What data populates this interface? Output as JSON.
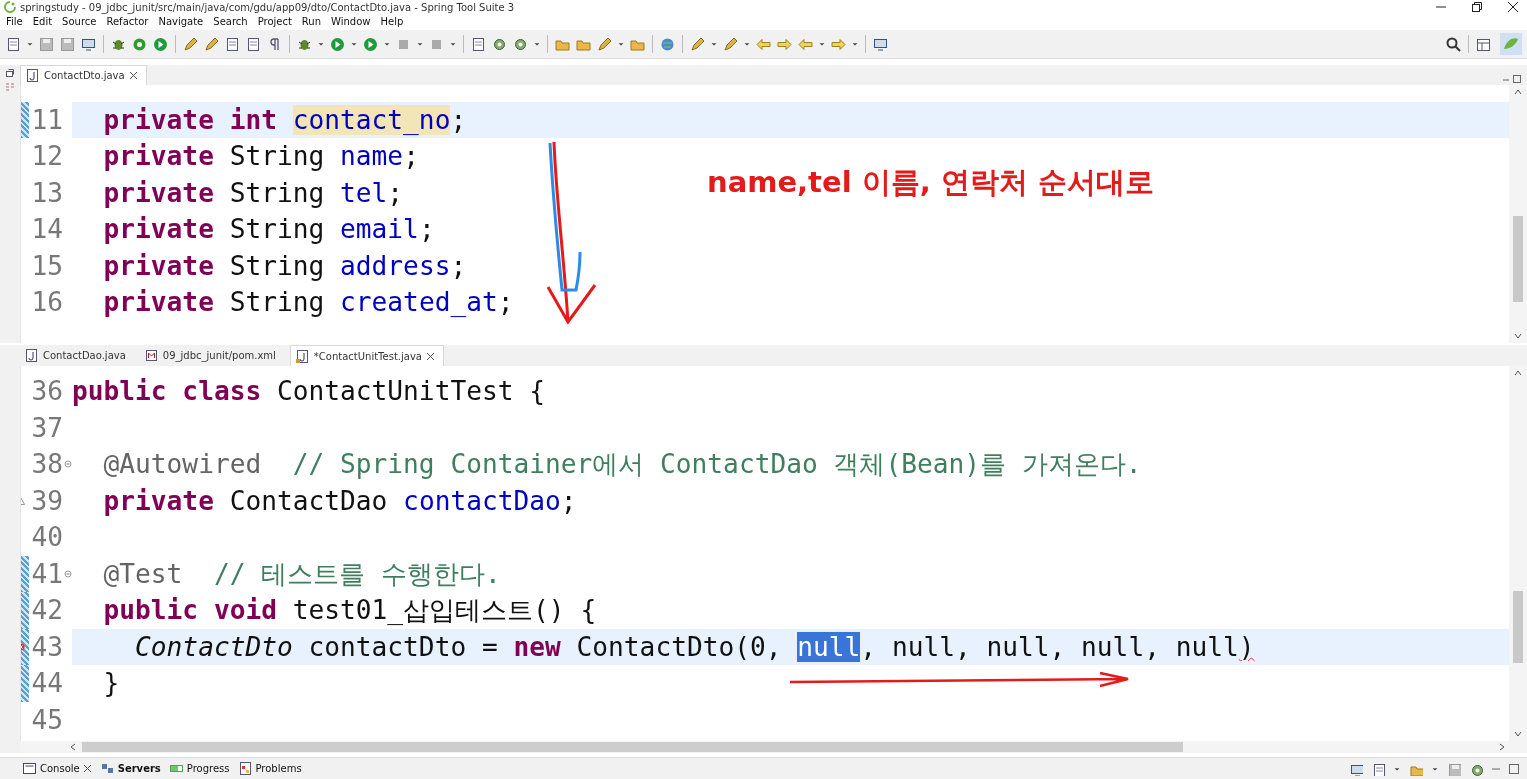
{
  "window": {
    "title": "springstudy - 09_jdbc_junit/src/main/java/com/gdu/app09/dto/ContactDto.java - Spring Tool Suite 3"
  },
  "menu": [
    "File",
    "Edit",
    "Source",
    "Refactor",
    "Navigate",
    "Search",
    "Project",
    "Run",
    "Window",
    "Help"
  ],
  "editors": [
    {
      "tabs": [
        {
          "kind": "java",
          "label": "ContactDto.java",
          "selected": true,
          "closable": true
        }
      ],
      "lines": [
        {
          "number": "11",
          "current": true,
          "changed": true,
          "tokens": [
            {
              "kind": "keyword",
              "text": "  private int "
            },
            {
              "kind": "occurrence",
              "text": "contact_no"
            },
            {
              "kind": "plain",
              "text": ";"
            }
          ]
        },
        {
          "number": "12",
          "current": false,
          "changed": false,
          "tokens": [
            {
              "kind": "keyword",
              "text": "  private"
            },
            {
              "kind": "plain",
              "text": " String "
            },
            {
              "kind": "field",
              "text": "name"
            },
            {
              "kind": "plain",
              "text": ";"
            }
          ]
        },
        {
          "number": "13",
          "current": false,
          "changed": false,
          "tokens": [
            {
              "kind": "keyword",
              "text": "  private"
            },
            {
              "kind": "plain",
              "text": " String "
            },
            {
              "kind": "field",
              "text": "tel"
            },
            {
              "kind": "plain",
              "text": ";"
            }
          ]
        },
        {
          "number": "14",
          "current": false,
          "changed": false,
          "tokens": [
            {
              "kind": "keyword",
              "text": "  private"
            },
            {
              "kind": "plain",
              "text": " String "
            },
            {
              "kind": "field",
              "text": "email"
            },
            {
              "kind": "plain",
              "text": ";"
            }
          ]
        },
        {
          "number": "15",
          "current": false,
          "changed": false,
          "tokens": [
            {
              "kind": "keyword",
              "text": "  private"
            },
            {
              "kind": "plain",
              "text": " String "
            },
            {
              "kind": "field",
              "text": "address"
            },
            {
              "kind": "plain",
              "text": ";"
            }
          ]
        },
        {
          "number": "16",
          "current": false,
          "changed": false,
          "tokens": [
            {
              "kind": "keyword",
              "text": "  private"
            },
            {
              "kind": "plain",
              "text": " String "
            },
            {
              "kind": "field",
              "text": "created_at"
            },
            {
              "kind": "plain",
              "text": ";"
            }
          ]
        }
      ]
    },
    {
      "tabs": [
        {
          "kind": "java",
          "label": "ContactDao.java",
          "selected": false,
          "closable": false
        },
        {
          "kind": "pom",
          "label": "09_jdbc_junit/pom.xml",
          "selected": false,
          "closable": false
        },
        {
          "kind": "test",
          "label": "*ContactUnitTest.java",
          "selected": true,
          "closable": true
        }
      ],
      "lines": [
        {
          "number": "36",
          "current": false,
          "changed": false,
          "foldable": false,
          "warning": false,
          "error": false,
          "tokens": [
            {
              "kind": "keyword",
              "text": "public class"
            },
            {
              "kind": "plain",
              "text": " ContactUnitTest {"
            }
          ]
        },
        {
          "number": "37",
          "current": false,
          "changed": false,
          "foldable": false,
          "warning": false,
          "error": false
        },
        {
          "number": "38",
          "current": false,
          "changed": false,
          "foldable": true,
          "warning": false,
          "error": false,
          "tokens": [
            {
              "kind": "annotation",
              "text": "  @Autowired"
            },
            {
              "kind": "comment",
              "text": "  // Spring Container에서 ContactDao 객체(Bean)를 가져온다."
            }
          ]
        },
        {
          "number": "39",
          "current": false,
          "changed": false,
          "foldable": false,
          "warning": true,
          "error": false,
          "tokens": [
            {
              "kind": "keyword",
              "text": "  private"
            },
            {
              "kind": "plain",
              "text": " ContactDao "
            },
            {
              "kind": "field",
              "text": "contactDao"
            },
            {
              "kind": "plain",
              "text": ";"
            }
          ]
        },
        {
          "number": "40",
          "current": false,
          "changed": false,
          "foldable": false,
          "warning": false,
          "error": false
        },
        {
          "number": "41",
          "current": false,
          "changed": true,
          "foldable": true,
          "warning": false,
          "error": false,
          "tokens": [
            {
              "kind": "annotation",
              "text": "  @Test"
            },
            {
              "kind": "comment",
              "text": "  // 테스트를 수행한다."
            }
          ]
        },
        {
          "number": "42",
          "current": false,
          "changed": true,
          "foldable": false,
          "warning": false,
          "error": false,
          "tokens": [
            {
              "kind": "keyword",
              "text": "  public void"
            },
            {
              "kind": "plain",
              "text": " test01_삽입테스트() {"
            }
          ]
        },
        {
          "number": "43",
          "current": true,
          "changed": true,
          "foldable": false,
          "warning": false,
          "error": true,
          "tokens": [
            {
              "kind": "type",
              "text": "    ContactDto"
            },
            {
              "kind": "plain",
              "text": " contactDto = "
            },
            {
              "kind": "keyword",
              "text": "new"
            },
            {
              "kind": "plain",
              "text": " ContactDto(0, "
            },
            {
              "kind": "selected",
              "text": "null"
            },
            {
              "kind": "plain",
              "text": ", null, null, null, null"
            },
            {
              "kind": "error",
              "text": ")"
            }
          ]
        },
        {
          "number": "44",
          "current": false,
          "changed": true,
          "foldable": false,
          "warning": false,
          "error": false,
          "tokens": [
            {
              "kind": "plain",
              "text": "  }"
            }
          ]
        },
        {
          "number": "45",
          "current": false,
          "changed": false,
          "foldable": false,
          "warning": false,
          "error": false
        }
      ]
    }
  ],
  "annotation": {
    "text": "name,tel 이름, 연락처 순서대로"
  },
  "bottom_panel": {
    "tabs": [
      {
        "kind": "console",
        "label": "Console",
        "selected": false,
        "closable": true
      },
      {
        "kind": "servers",
        "label": "Servers",
        "selected": true,
        "closable": false
      },
      {
        "kind": "progress",
        "label": "Progress",
        "selected": false,
        "closable": false
      },
      {
        "kind": "problems",
        "label": "Problems",
        "selected": false,
        "closable": false
      }
    ]
  }
}
